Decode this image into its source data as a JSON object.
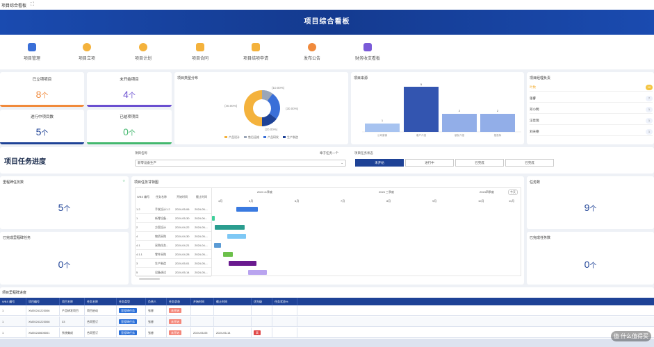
{
  "tab": {
    "title": "项目综合看板",
    "close": "⛶"
  },
  "banner": {
    "title": "项目综合看板"
  },
  "nav": [
    {
      "label": "项目管理",
      "icon": "project-icon",
      "color": "#3a6fd8"
    },
    {
      "label": "项目立项",
      "icon": "approval-icon",
      "color": "#f4b23c"
    },
    {
      "label": "项目计划",
      "icon": "plan-icon",
      "color": "#f4b23c"
    },
    {
      "label": "项目合同",
      "icon": "contract-icon",
      "color": "#f4b23c"
    },
    {
      "label": "项目结项申请",
      "icon": "closing-icon",
      "color": "#f4b23c"
    },
    {
      "label": "发布公告",
      "icon": "notice-icon",
      "color": "#f08a3c"
    },
    {
      "label": "财务收支看板",
      "icon": "finance-icon",
      "color": "#7a5ad8"
    }
  ],
  "stats": [
    {
      "title": "已立项项目",
      "value": "8",
      "unit": "个",
      "color": "#f08a3c"
    },
    {
      "title": "未开始项目",
      "value": "4",
      "unit": "个",
      "color": "#6a4fd0"
    },
    {
      "title": "进行中项目数",
      "value": "5",
      "unit": "个",
      "color": "#1e4296"
    },
    {
      "title": "已结项项目",
      "value": "0",
      "unit": "个",
      "color": "#43b86e"
    }
  ],
  "pie": {
    "title": "项目类型分布",
    "labels": {
      "top": "(10.00%)",
      "left": "(40.00%)",
      "right": "(30.00%)",
      "bottom": "(20.00%)"
    },
    "legend": [
      "产品设计",
      "售后运维",
      "产品研发",
      "生产制造"
    ]
  },
  "source": {
    "title": "项目来源"
  },
  "managers": {
    "title": "项目经理负责",
    "rows": [
      {
        "name": "叶数",
        "count": "10",
        "active": true
      },
      {
        "name": "张睿",
        "count": "7",
        "active": false
      },
      {
        "name": "邓小明",
        "count": "1",
        "active": false
      },
      {
        "name": "汪佳瑞",
        "count": "1",
        "active": false
      },
      {
        "name": "刘天德",
        "count": "1",
        "active": false
      }
    ]
  },
  "section": {
    "title": "项目任务进度"
  },
  "filters": {
    "name_label": "项目名称",
    "name_value": "新零设备生产",
    "sort_label": "章子任务一个",
    "status_label": "项目任务状态",
    "status_options": [
      "未开始",
      "进行中",
      "已完成",
      "已完成"
    ]
  },
  "milestone": {
    "title": "里程碑任务数",
    "value": "5",
    "unit": "个"
  },
  "done_milestone": {
    "title": "已完成里程碑任务",
    "value": "0",
    "unit": "个"
  },
  "task_count": {
    "title": "任务数",
    "value": "9",
    "unit": "个"
  },
  "done_task": {
    "title": "已完成任务数",
    "value": "0",
    "unit": "个"
  },
  "gantt": {
    "title": "项目任务甘特图",
    "headers": [
      "WBS 编号",
      "任务名称",
      "开始时间",
      "截止时间"
    ],
    "quarters": [
      "2024 二季度",
      "2024 三季度",
      "2024四季度"
    ],
    "today": "今天",
    "months": [
      "4月",
      "5月",
      "6月",
      "7月",
      "8月",
      "9月",
      "10月",
      "11月"
    ],
    "rows": [
      {
        "wbs": "1.2",
        "name": "手杖设计1.2",
        "start": "2024-05-06",
        "end": "2024-05-..."
      },
      {
        "wbs": "1",
        "name": "新零设备...",
        "start": "2024-05-30",
        "end": "2024-06..."
      },
      {
        "wbs": "2",
        "name": "方案设计",
        "start": "2024-04-22",
        "end": "2024-05-..."
      },
      {
        "wbs": "4",
        "name": "物资采购",
        "start": "2024-04-30",
        "end": "2024-05-..."
      },
      {
        "wbs": "4.1",
        "name": "采购任务...",
        "start": "2024-04-21",
        "end": "2024-04-..."
      },
      {
        "wbs": "4.1.1",
        "name": "零件采购",
        "start": "2024-04-28",
        "end": "2024-05-..."
      },
      {
        "wbs": "3",
        "name": "生产制造",
        "start": "2024-05-01",
        "end": "2024-05-..."
      },
      {
        "wbs": "5",
        "name": "设备调试",
        "start": "2024-05-14",
        "end": "2024-05-..."
      }
    ]
  },
  "table": {
    "title": "项目里程碑进度",
    "headers": [
      "WBS 编号",
      "项目编号",
      "项目名称",
      "任务名称",
      "任务类型",
      "负责人",
      "任务状态",
      "开始时间",
      "截止时间",
      "优先级",
      "任务状态%"
    ],
    "rows": [
      {
        "wbs": "1",
        "code": "XM20241223006",
        "name": "产品研发项目",
        "task": "项目启动",
        "type": "里程碑任务",
        "owner": "张睿",
        "status": "未开始",
        "start": "",
        "end": "",
        "priority": ""
      },
      {
        "wbs": "1",
        "code": "XM20241223008",
        "name": "33",
        "task": "合同签订",
        "type": "里程碑任务",
        "owner": "张睿",
        "status": "未开始",
        "start": "",
        "end": "",
        "priority": ""
      },
      {
        "wbs": "1",
        "code": "XM20240605001",
        "name": "系统集成",
        "task": "合同签订",
        "type": "里程碑任务",
        "owner": "张睿",
        "status": "未开始",
        "start": "2024-06-05",
        "end": "2024-06-14",
        "priority": "高"
      }
    ]
  },
  "watermark": "值 什么值得买",
  "colors": {
    "primary": "#1e4296",
    "accent": "#f4c542",
    "orange": "#f08a3c"
  }
}
